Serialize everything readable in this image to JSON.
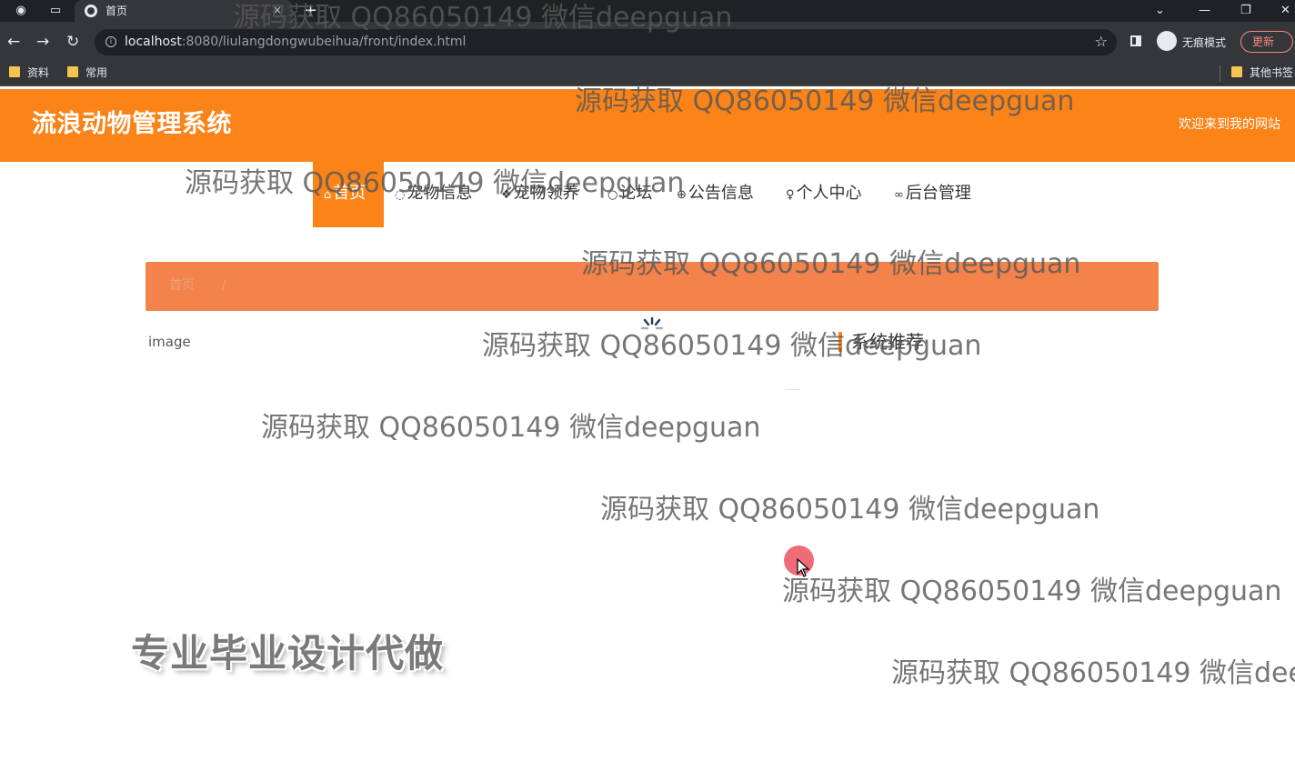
{
  "browser": {
    "tab_title": "首页",
    "tab_close": "×",
    "new_tab": "+",
    "url_host": "localhost",
    "url_rest": ":8080/liulangdongwubeihua/front/index.html",
    "incognito_label": "无痕模式",
    "update_label": "更新",
    "bookmarks": [
      "资料",
      "常用"
    ],
    "other_bookmarks": "其他书签",
    "icons": {
      "back": "arrow-left-icon",
      "forward": "arrow-right-icon",
      "reload": "reload-icon",
      "star": "star-icon"
    }
  },
  "site": {
    "title": "流浪动物管理系统",
    "welcome": "欢迎来到我的网站",
    "brand_color": "#fb8317"
  },
  "nav": {
    "items": [
      {
        "label": "首页",
        "icon": "home-icon"
      },
      {
        "label": "宠物信息",
        "icon": "paw-icon"
      },
      {
        "label": "宠物领养",
        "icon": "heart-icon"
      },
      {
        "label": "论坛",
        "icon": "chat-icon"
      },
      {
        "label": "公告信息",
        "icon": "globe-icon"
      },
      {
        "label": "个人中心",
        "icon": "user-icon"
      },
      {
        "label": "后台管理",
        "icon": "link-icon"
      }
    ],
    "active_index": 0
  },
  "breadcrumb": {
    "home": "首页",
    "separator": "/"
  },
  "main": {
    "image_alt": "image",
    "recommend_title": "系统推荐"
  },
  "overlay": {
    "watermark": "源码获取 QQ86050149 微信deepguan",
    "promo": "专业毕业设计代做"
  }
}
